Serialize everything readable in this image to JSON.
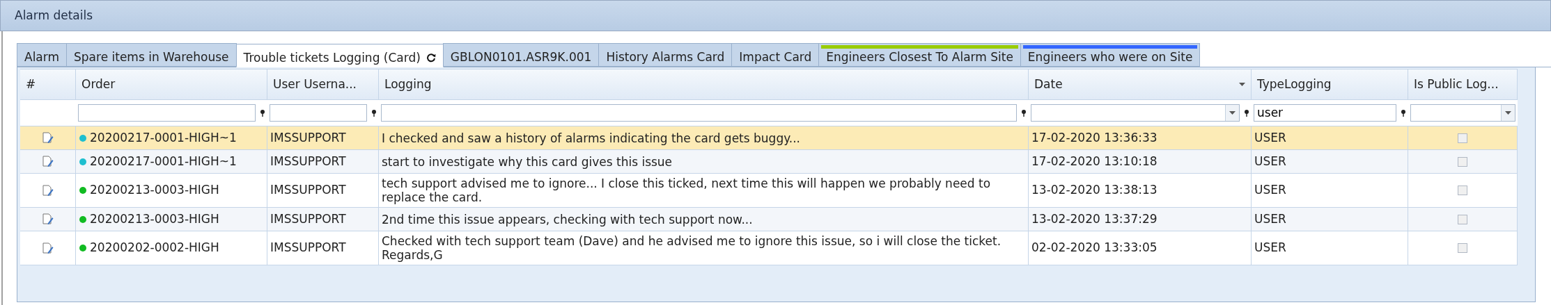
{
  "panel": {
    "title": "Alarm details"
  },
  "tabs": [
    {
      "label": "Alarm",
      "selected": false
    },
    {
      "label": "Spare items in Warehouse",
      "selected": false
    },
    {
      "label": "Trouble tickets Logging (Card)",
      "selected": true
    },
    {
      "label": "GBLON0101.ASR9K.001",
      "selected": false
    },
    {
      "label": "History Alarms Card",
      "selected": false
    },
    {
      "label": "Impact Card",
      "selected": false
    },
    {
      "label": "Engineers Closest To Alarm Site",
      "selected": false,
      "color": "#99cc00"
    },
    {
      "label": "Engineers who were on Site",
      "selected": false,
      "color": "#3366ff"
    }
  ],
  "table": {
    "columns": [
      {
        "label": "#"
      },
      {
        "label": "Order",
        "filter": {
          "kind": "text"
        }
      },
      {
        "label": "User Userna...",
        "filter": {
          "kind": "text"
        }
      },
      {
        "label": "Logging",
        "filter": {
          "kind": "text"
        }
      },
      {
        "label": "Date",
        "sorted": true,
        "filter": {
          "kind": "combo"
        }
      },
      {
        "label": "TypeLogging",
        "filter": {
          "kind": "text",
          "value": "user"
        }
      },
      {
        "label": "Is Public Log...",
        "filter": {
          "kind": "combo-only"
        }
      }
    ],
    "rows": [
      {
        "selected": true,
        "color": "#1fbfcf",
        "order": "20200217-0001-HIGH~1",
        "user": "IMSSUPPORT",
        "logging": "I checked and saw a history of alarms indicating the card gets buggy...",
        "date": "17-02-2020 13:36:33",
        "type": "USER",
        "public": false
      },
      {
        "selected": false,
        "color": "#1fbfcf",
        "order": "20200217-0001-HIGH~1",
        "user": "IMSSUPPORT",
        "logging": "start to investigate why this card gives this issue",
        "date": "17-02-2020 13:10:18",
        "type": "USER",
        "public": false
      },
      {
        "selected": false,
        "color": "#11bb22",
        "order": "20200213-0003-HIGH",
        "user": "IMSSUPPORT",
        "logging": "tech support advised me to ignore...  I close this ticked, next time this will happen we probably need to replace the card.",
        "date": "13-02-2020 13:38:13",
        "type": "USER",
        "public": false
      },
      {
        "selected": false,
        "color": "#11bb22",
        "order": "20200213-0003-HIGH",
        "user": "IMSSUPPORT",
        "logging": "2nd time this issue appears, checking with tech support now...",
        "date": "13-02-2020 13:37:29",
        "type": "USER",
        "public": false
      },
      {
        "selected": false,
        "color": "#11bb22",
        "order": "20200202-0002-HIGH",
        "user": "IMSSUPPORT",
        "logging": "Checked with tech support team (Dave)  and he advised me to ignore this issue, so i will close the ticket.\nRegards,G",
        "date": "02-02-2020 13:33:05",
        "type": "USER",
        "public": false
      }
    ]
  }
}
